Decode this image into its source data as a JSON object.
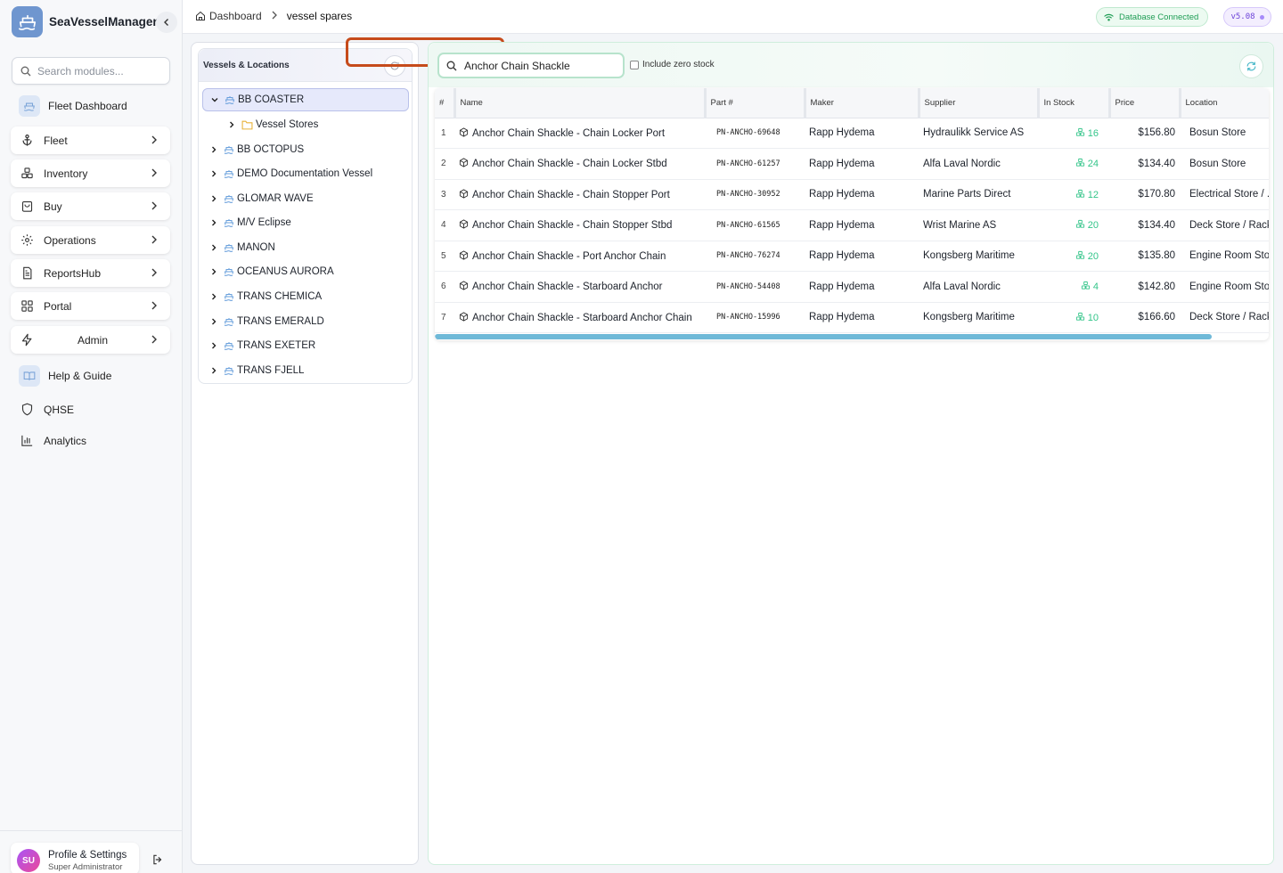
{
  "app": {
    "name": "SeaVesselManager"
  },
  "sidebar": {
    "search_placeholder": "Search modules...",
    "items": [
      {
        "label": "Fleet Dashboard"
      },
      {
        "label": "Fleet"
      },
      {
        "label": "Inventory"
      },
      {
        "label": "Buy"
      },
      {
        "label": "Operations"
      },
      {
        "label": "ReportsHub"
      },
      {
        "label": "Portal"
      },
      {
        "label": "Admin"
      },
      {
        "label": "Help & Guide"
      },
      {
        "label": "QHSE"
      },
      {
        "label": "Analytics"
      }
    ],
    "profile": {
      "initials": "SU",
      "name": "Profile & Settings",
      "role": "Super Administrator"
    }
  },
  "topbar": {
    "breadcrumb": [
      "Dashboard",
      "vessel spares"
    ],
    "db_status": "Database Connected",
    "version": "v5.08"
  },
  "tree": {
    "title": "Vessels & Locations",
    "nodes": [
      {
        "label": "BB COASTER",
        "expanded": true
      },
      {
        "label": "Vessel Stores"
      },
      {
        "label": "BB OCTOPUS"
      },
      {
        "label": "DEMO Documentation Vessel"
      },
      {
        "label": "GLOMAR WAVE"
      },
      {
        "label": "M/V Eclipse"
      },
      {
        "label": "MANON"
      },
      {
        "label": "OCEANUS AURORA"
      },
      {
        "label": "TRANS CHEMICA"
      },
      {
        "label": "TRANS EMERALD"
      },
      {
        "label": "TRANS EXETER"
      },
      {
        "label": "TRANS FJELL"
      }
    ]
  },
  "parts": {
    "search_value": "Anchor Chain Shackle",
    "include_zero_stock_label": "Include zero stock",
    "columns": [
      "#",
      "Name",
      "Part #",
      "Maker",
      "Supplier",
      "In Stock",
      "Price",
      "Location"
    ],
    "rows": [
      {
        "n": "1",
        "name": "Anchor Chain Shackle - Chain Locker Port",
        "part": "PN-ANCHO-69648",
        "maker": "Rapp Hydema",
        "supplier": "Hydraulikk Service AS",
        "stock": "16",
        "price": "$156.80",
        "location": "Bosun Store"
      },
      {
        "n": "2",
        "name": "Anchor Chain Shackle - Chain Locker Stbd",
        "part": "PN-ANCHO-61257",
        "maker": "Rapp Hydema",
        "supplier": "Alfa Laval Nordic",
        "stock": "24",
        "price": "$134.40",
        "location": "Bosun Store"
      },
      {
        "n": "3",
        "name": "Anchor Chain Shackle - Chain Stopper Port",
        "part": "PN-ANCHO-30952",
        "maker": "Rapp Hydema",
        "supplier": "Marine Parts Direct",
        "stock": "12",
        "price": "$170.80",
        "location": "Electrical Store / ..."
      },
      {
        "n": "4",
        "name": "Anchor Chain Shackle - Chain Stopper Stbd",
        "part": "PN-ANCHO-61565",
        "maker": "Rapp Hydema",
        "supplier": "Wrist Marine AS",
        "stock": "20",
        "price": "$134.40",
        "location": "Deck Store / Rack"
      },
      {
        "n": "5",
        "name": "Anchor Chain Shackle - Port Anchor Chain",
        "part": "PN-ANCHO-76274",
        "maker": "Rapp Hydema",
        "supplier": "Kongsberg Maritime",
        "stock": "20",
        "price": "$135.80",
        "location": "Engine Room Store"
      },
      {
        "n": "6",
        "name": "Anchor Chain Shackle - Starboard Anchor",
        "part": "PN-ANCHO-54408",
        "maker": "Rapp Hydema",
        "supplier": "Alfa Laval Nordic",
        "stock": "4",
        "price": "$142.80",
        "location": "Engine Room Store"
      },
      {
        "n": "7",
        "name": "Anchor Chain Shackle - Starboard Anchor Chain",
        "part": "PN-ANCHO-15996",
        "maker": "Rapp Hydema",
        "supplier": "Kongsberg Maritime",
        "stock": "10",
        "price": "$166.60",
        "location": "Deck Store / Rack"
      }
    ]
  },
  "colors": {
    "accent_green": "#34c58a",
    "selection": "#e6e9fb",
    "annotation": "#c64b1b"
  }
}
